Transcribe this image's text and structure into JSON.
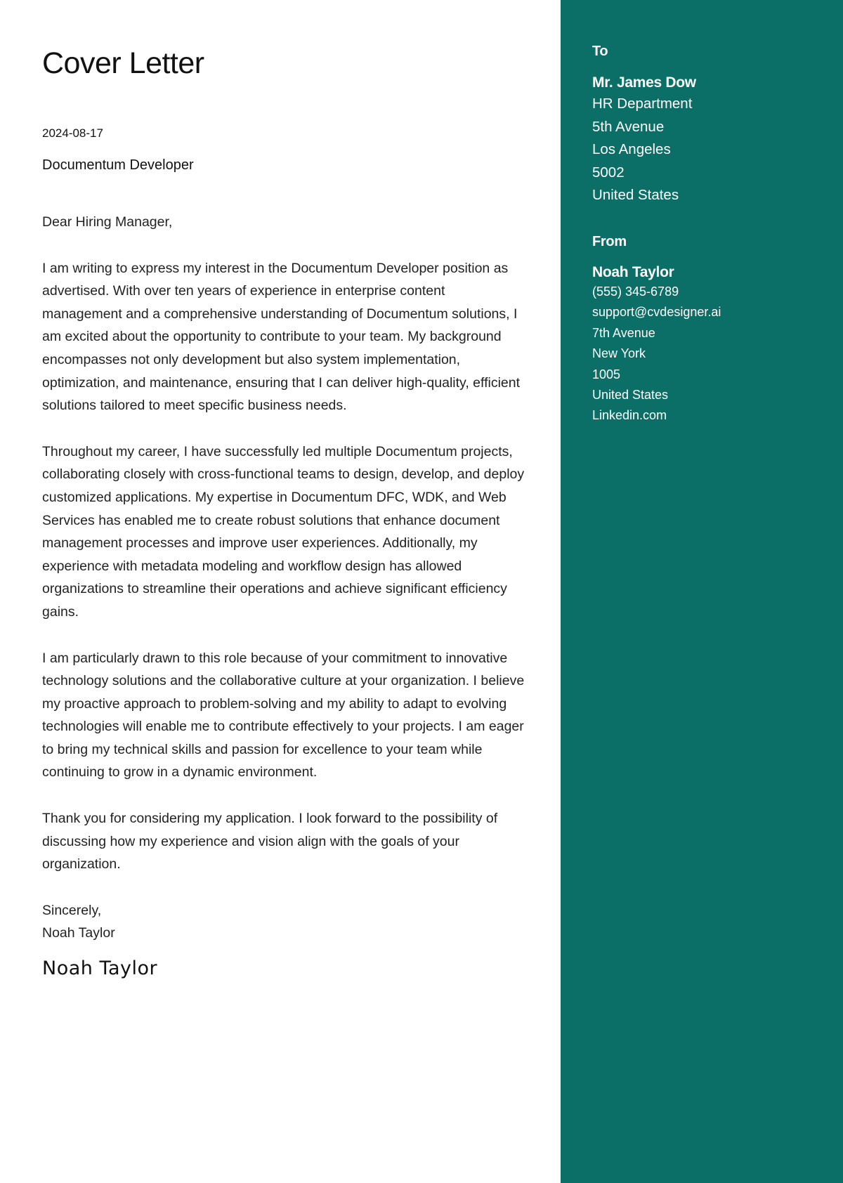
{
  "letter": {
    "title": "Cover Letter",
    "date": "2024-08-17",
    "job_title": "Documentum Developer",
    "salutation": "Dear Hiring Manager,",
    "paragraphs": [
      "I am writing to express my interest in the Documentum Developer position as advertised. With over ten years of experience in enterprise content management and a comprehensive understanding of Documentum solutions, I am excited about the opportunity to contribute to your team. My background encompasses not only development but also system implementation, optimization, and maintenance, ensuring that I can deliver high-quality, efficient solutions tailored to meet specific business needs.",
      "Throughout my career, I have successfully led multiple Documentum projects, collaborating closely with cross-functional teams to design, develop, and deploy customized applications. My expertise in Documentum DFC, WDK, and Web Services has enabled me to create robust solutions that enhance document management processes and improve user experiences. Additionally, my experience with metadata modeling and workflow design has allowed organizations to streamline their operations and achieve significant efficiency gains.",
      "I am particularly drawn to this role because of your commitment to innovative technology solutions and the collaborative culture at your organization. I believe my proactive approach to problem-solving and my ability to adapt to evolving technologies will enable me to contribute effectively to your projects. I am eager to bring my technical skills and passion for excellence to your team while continuing to grow in a dynamic environment.",
      "Thank you for considering my application. I look forward to the possibility of discussing how my experience and vision align with the goals of your organization."
    ],
    "closing": "Sincerely,",
    "closing_name": "Noah Taylor",
    "signature": "Noah Taylor"
  },
  "sidebar": {
    "accent_color": "#0b6e67",
    "to": {
      "label": "To",
      "name": "Mr. James Dow",
      "lines": [
        "HR Department",
        "5th Avenue",
        "Los Angeles",
        "5002",
        "United States"
      ]
    },
    "from": {
      "label": "From",
      "name": "Noah Taylor",
      "phone": "(555) 345-6789",
      "email": "support@cvdesigner.ai",
      "lines": [
        "7th Avenue",
        "New York",
        "1005",
        "United States"
      ],
      "website": "Linkedin.com"
    }
  }
}
